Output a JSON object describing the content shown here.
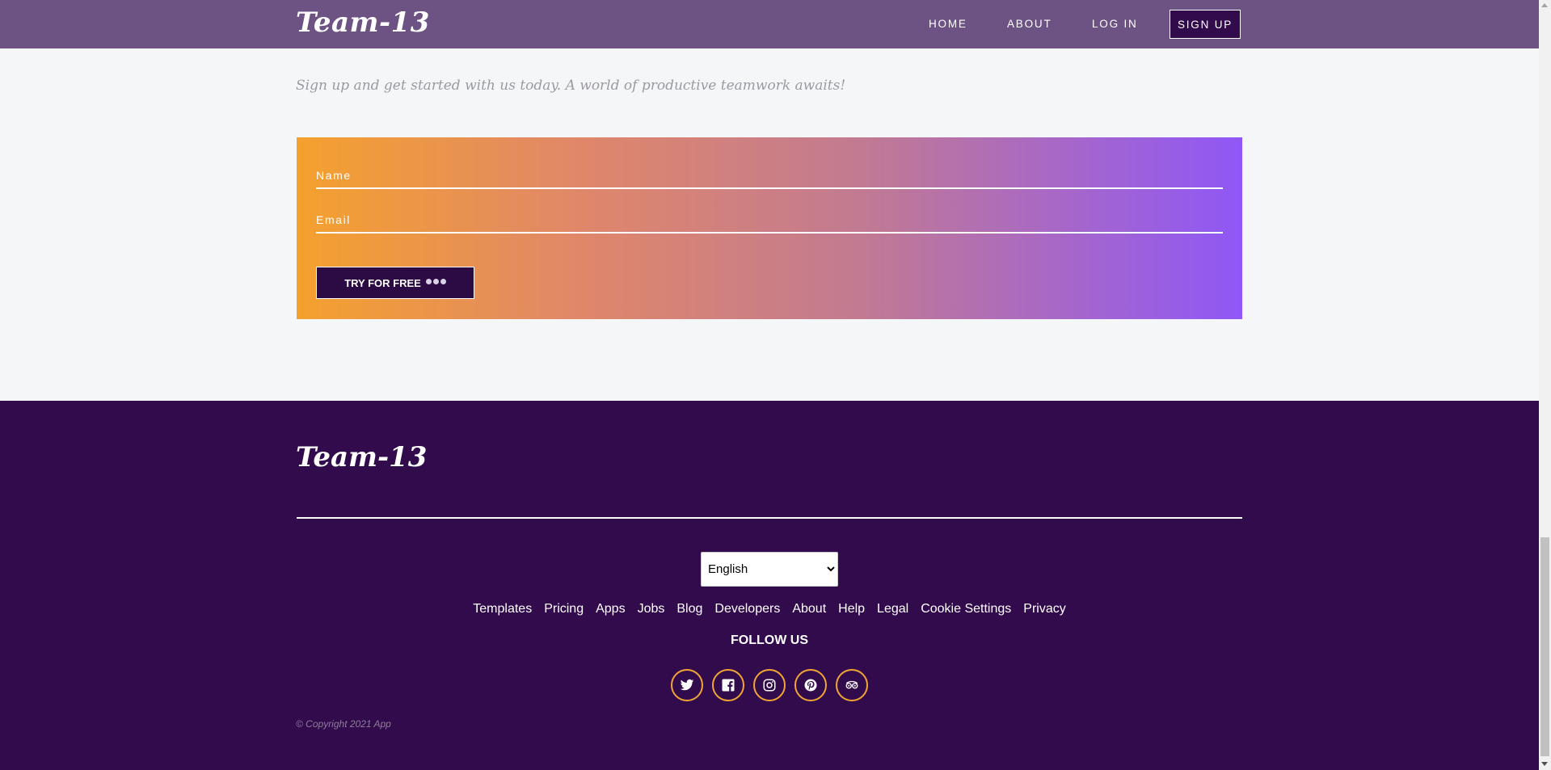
{
  "header": {
    "brand": "Team-13",
    "nav": {
      "home": "HOME",
      "about": "ABOUT",
      "login": "LOG IN",
      "signup": "SIGN UP"
    }
  },
  "main": {
    "tagline": "Sign up and get started with us today. A world of productive teamwork awaits!",
    "form": {
      "name_placeholder": "Name",
      "email_placeholder": "Email",
      "submit_label": "TRY FOR FREE"
    }
  },
  "footer": {
    "brand": "Team-13",
    "language": {
      "selected": "English"
    },
    "links": [
      "Templates",
      "Pricing",
      "Apps",
      "Jobs",
      "Blog",
      "Developers",
      "About",
      "Help",
      "Legal",
      "Cookie Settings",
      "Privacy"
    ],
    "follow_title": "FOLLOW US",
    "social": [
      "twitter-icon",
      "facebook-icon",
      "instagram-icon",
      "pinterest-icon",
      "tripadvisor-icon"
    ],
    "copyright": "© Copyright 2021 App"
  },
  "colors": {
    "header_bg": "#6d5383",
    "footer_bg": "#320b4c",
    "gradient_start": "#f4a12e",
    "gradient_end": "#8f57f7",
    "social_ring": "#f1a534"
  }
}
